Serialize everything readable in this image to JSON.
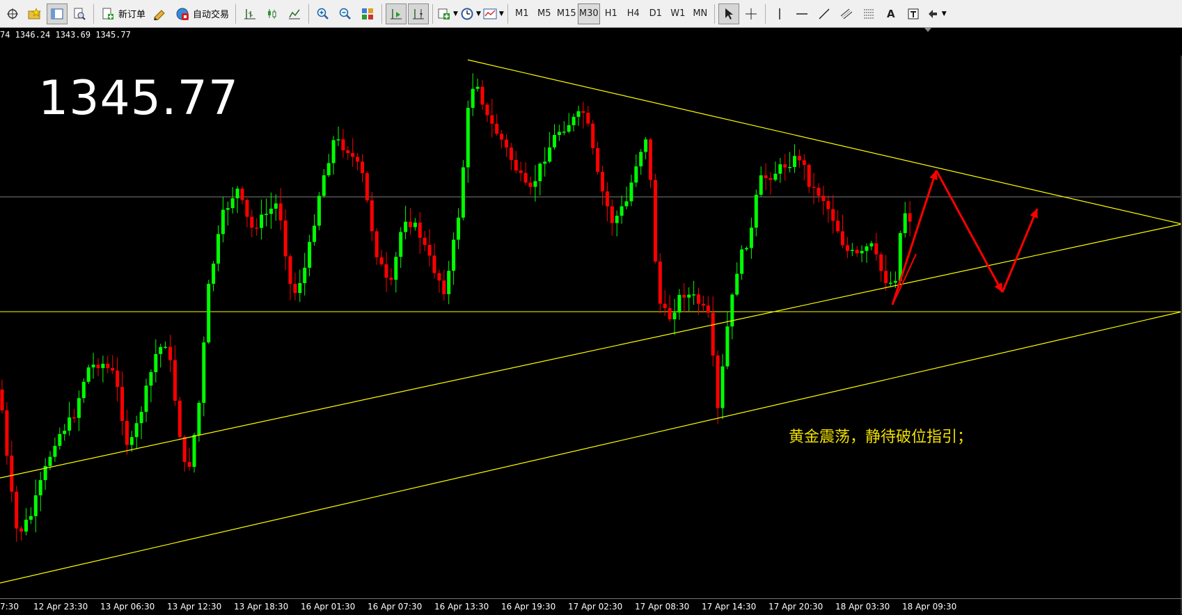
{
  "toolbar": {
    "new_order_label": "新订单",
    "auto_trade_label": "自动交易",
    "timeframes": [
      "M1",
      "M5",
      "M15",
      "M30",
      "H1",
      "H4",
      "D1",
      "W1",
      "MN"
    ],
    "active_timeframe": "M30"
  },
  "chart": {
    "ohlc_text": "74 1346.24 1343.69 1345.77",
    "big_price": "1345.77",
    "annotation": "黄金震荡，静待破位指引；",
    "colors": {
      "background": "#000000",
      "bull_candle": "#00ff00",
      "bear_candle": "#ff0000",
      "trendline": "#ffff00",
      "bid_line": "#808080",
      "projection_arrow": "#ff0000"
    },
    "time_labels": [
      "7:30",
      "12 Apr 23:30",
      "13 Apr 06:30",
      "13 Apr 12:30",
      "13 Apr 18:30",
      "16 Apr 01:30",
      "16 Apr 07:30",
      "16 Apr 13:30",
      "16 Apr 19:30",
      "17 Apr 02:30",
      "17 Apr 08:30",
      "17 Apr 14:30",
      "17 Apr 20:30",
      "18 Apr 03:30",
      "18 Apr 09:30"
    ]
  }
}
